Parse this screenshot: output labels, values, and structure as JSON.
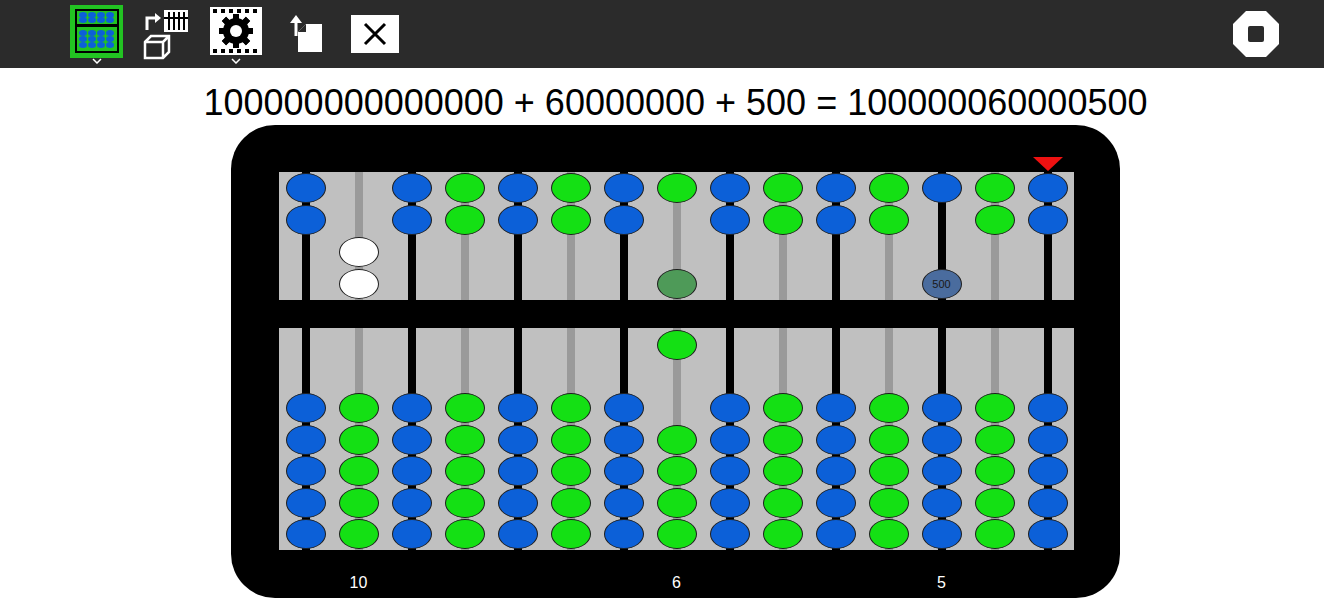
{
  "toolbar": {
    "buttons": [
      {
        "kind": "abacus",
        "selected": true,
        "has_menu": true
      },
      {
        "kind": "transfer",
        "selected": false,
        "has_menu": false
      },
      {
        "kind": "settings",
        "selected": false,
        "has_menu": true
      },
      {
        "kind": "export",
        "selected": false,
        "has_menu": false
      },
      {
        "kind": "close",
        "selected": false,
        "has_menu": false
      }
    ],
    "stop_button": {
      "kind": "stop"
    }
  },
  "equation": "100000000000000 + 60000000 + 500 = 100000060000500",
  "abacus": {
    "rods": [
      {
        "color": "#0c60d8",
        "rod_color": "#000000",
        "upper_down": 0,
        "lower_up": 0,
        "upper_active_color": "",
        "bead_text": "",
        "label": "",
        "marker": false
      },
      {
        "color": "#14e014",
        "rod_color": "#9a9a9a",
        "upper_down": 2,
        "lower_up": 0,
        "upper_active_color": "#ffffff",
        "bead_text": "",
        "label": "10",
        "marker": false
      },
      {
        "color": "#0c60d8",
        "rod_color": "#000000",
        "upper_down": 0,
        "lower_up": 0,
        "upper_active_color": "",
        "bead_text": "",
        "label": "",
        "marker": false
      },
      {
        "color": "#14e014",
        "rod_color": "#9a9a9a",
        "upper_down": 0,
        "lower_up": 0,
        "upper_active_color": "",
        "bead_text": "",
        "label": "",
        "marker": false
      },
      {
        "color": "#0c60d8",
        "rod_color": "#000000",
        "upper_down": 0,
        "lower_up": 0,
        "upper_active_color": "",
        "bead_text": "",
        "label": "",
        "marker": false
      },
      {
        "color": "#14e014",
        "rod_color": "#9a9a9a",
        "upper_down": 0,
        "lower_up": 0,
        "upper_active_color": "",
        "bead_text": "",
        "label": "",
        "marker": false
      },
      {
        "color": "#0c60d8",
        "rod_color": "#000000",
        "upper_down": 0,
        "lower_up": 0,
        "upper_active_color": "",
        "bead_text": "",
        "label": "",
        "marker": false
      },
      {
        "color": "#14e014",
        "rod_color": "#9a9a9a",
        "upper_down": 1,
        "lower_up": 1,
        "upper_active_color": "#4e9a58",
        "bead_text": "",
        "label": "6",
        "marker": false
      },
      {
        "color": "#0c60d8",
        "rod_color": "#000000",
        "upper_down": 0,
        "lower_up": 0,
        "upper_active_color": "",
        "bead_text": "",
        "label": "",
        "marker": false
      },
      {
        "color": "#14e014",
        "rod_color": "#9a9a9a",
        "upper_down": 0,
        "lower_up": 0,
        "upper_active_color": "",
        "bead_text": "",
        "label": "",
        "marker": false
      },
      {
        "color": "#0c60d8",
        "rod_color": "#000000",
        "upper_down": 0,
        "lower_up": 0,
        "upper_active_color": "",
        "bead_text": "",
        "label": "",
        "marker": false
      },
      {
        "color": "#14e014",
        "rod_color": "#9a9a9a",
        "upper_down": 0,
        "lower_up": 0,
        "upper_active_color": "",
        "bead_text": "",
        "label": "",
        "marker": false
      },
      {
        "color": "#0c60d8",
        "rod_color": "#000000",
        "upper_down": 1,
        "lower_up": 0,
        "upper_active_color": "#4a6c9e",
        "bead_text": "500",
        "label": "5",
        "marker": false
      },
      {
        "color": "#14e014",
        "rod_color": "#9a9a9a",
        "upper_down": 0,
        "lower_up": 0,
        "upper_active_color": "",
        "bead_text": "",
        "label": "",
        "marker": false
      },
      {
        "color": "#0c60d8",
        "rod_color": "#000000",
        "upper_down": 0,
        "lower_up": 0,
        "upper_active_color": "",
        "bead_text": "",
        "label": "",
        "marker": true
      }
    ]
  }
}
